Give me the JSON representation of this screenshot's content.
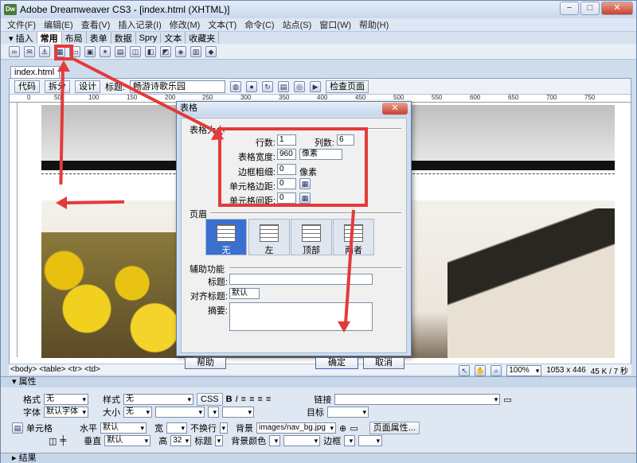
{
  "app": {
    "title": "Adobe Dreamweaver CS3 - [index.html (XHTML)]",
    "icon_text": "Dw",
    "min": "−",
    "max": "□",
    "close": "✕"
  },
  "menu": [
    "文件(F)",
    "编辑(E)",
    "查看(V)",
    "插入记录(I)",
    "修改(M)",
    "文本(T)",
    "命令(C)",
    "站点(S)",
    "窗口(W)",
    "帮助(H)"
  ],
  "insert": {
    "label": "▾ 插入",
    "tabs": [
      "常用",
      "布局",
      "表单",
      "数据",
      "Spry",
      "文本",
      "收藏夹"
    ]
  },
  "document": {
    "tab": "index.html",
    "code": "代码",
    "split": "拆分",
    "design": "设计",
    "title_label": "标题:",
    "title_value": "畅游诗歌乐园",
    "check": "检查页面"
  },
  "ruler": [
    "0",
    "50",
    "100",
    "150",
    "200",
    "250",
    "300",
    "350",
    "400",
    "450",
    "500",
    "550",
    "600",
    "650",
    "700",
    "750"
  ],
  "tagbar": {
    "tags": "<body> <table> <tr> <td>",
    "zoom": "100%",
    "size": "1053 x 446",
    "weight": "45 K / 7 秒"
  },
  "properties": {
    "header": "▾ 属性",
    "format_label": "格式",
    "format_value": "无",
    "style_label": "样式",
    "style_value": "无",
    "css": "CSS",
    "bold": "B",
    "italic": "I",
    "link_label": "链接",
    "font_label": "字体",
    "font_value": "默认字体",
    "size_label": "大小",
    "size_value": "无",
    "target_label": "目标",
    "cell_label": "单元格",
    "horz_label": "水平",
    "horz_value": "默认",
    "width_label": "宽",
    "nowrap_label": "不换行",
    "bg_label": "背景",
    "bg_value": "images/nav_bg.jpg",
    "page_props": "页面属性...",
    "vert_label": "垂直",
    "vert_value": "默认",
    "height_label": "高",
    "height_value": "32",
    "header_label": "标题",
    "bgcolor_label": "背景颜色",
    "border_label": "边框"
  },
  "results": "▸ 结果",
  "dialog": {
    "title": "表格",
    "close": "✕",
    "size_section": "表格大小",
    "rows_label": "行数:",
    "rows": "1",
    "cols_label": "列数:",
    "cols": "6",
    "width_label": "表格宽度:",
    "width": "960",
    "unit": "像素",
    "border_label": "边框粗细:",
    "border": "0",
    "border_unit": "像素",
    "padding_label": "单元格边距:",
    "padding": "0",
    "spacing_label": "单元格间距:",
    "spacing": "0",
    "header_section": "页眉",
    "headers": [
      "无",
      "左",
      "顶部",
      "两者"
    ],
    "access_section": "辅助功能",
    "caption_label": "标题:",
    "align_label": "对齐标题:",
    "align_value": "默认",
    "summary_label": "摘要:",
    "help": "帮助",
    "ok": "确定",
    "cancel": "取消"
  },
  "colors": {
    "annotation": "#e43a3a",
    "selected_header": "#3b6fd0"
  }
}
